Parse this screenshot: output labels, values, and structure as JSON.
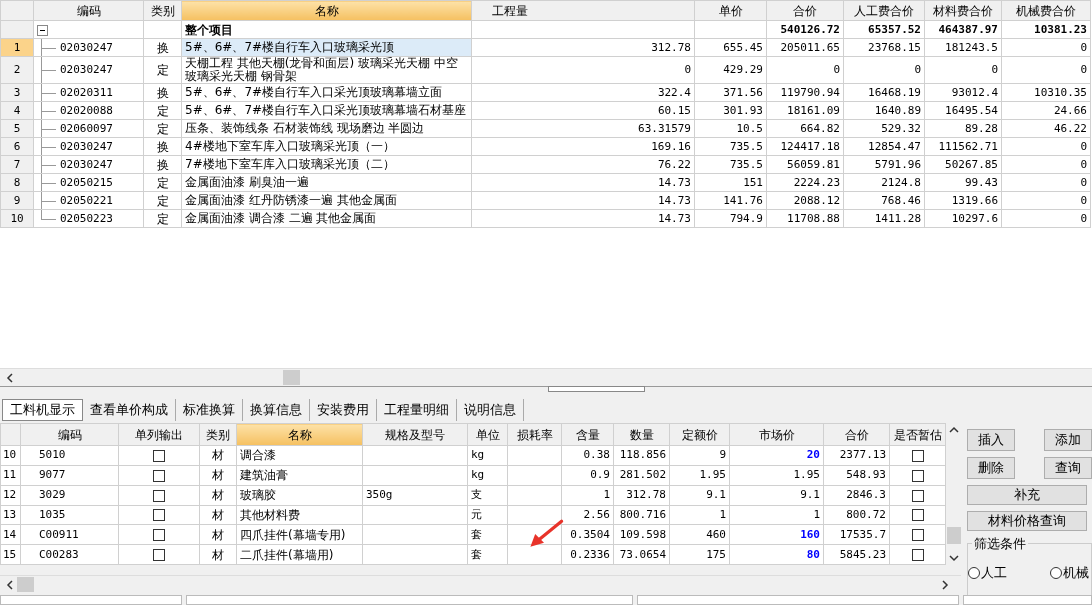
{
  "top_table": {
    "columns": [
      {
        "label": "编码",
        "selected": false
      },
      {
        "label": "类别",
        "selected": false
      },
      {
        "label": "名称",
        "selected": true
      },
      {
        "label": "工程量",
        "selected": false
      },
      {
        "label": "单价",
        "selected": false
      },
      {
        "label": "合价",
        "selected": false
      },
      {
        "label": "人工费合价",
        "selected": false
      },
      {
        "label": "材料费合价",
        "selected": false
      },
      {
        "label": "机械费合价",
        "selected": false
      }
    ],
    "root": {
      "name": "整个项目",
      "expanded": true,
      "total": "540126.72",
      "labor": "65357.52",
      "material": "464387.97",
      "machine": "10381.23",
      "children": [
        {
          "num": "1",
          "code": "02030247",
          "type": "换",
          "name": "5#、6#、7#楼自行车入口玻璃采光顶",
          "qty": "312.78",
          "price": "655.45",
          "total": "205011.65",
          "labor": "23768.15",
          "material": "181243.5",
          "machine": "0",
          "selected": true
        },
        {
          "num": "2",
          "code": "02030247",
          "type": "定",
          "name": "天棚工程 其他天棚(龙骨和面层) 玻璃采光天棚 中空玻璃采光天棚 钢骨架",
          "qty": "0",
          "price": "429.29",
          "total": "0",
          "labor": "0",
          "material": "0",
          "machine": "0",
          "selected": false
        },
        {
          "num": "3",
          "code": "02020311",
          "type": "换",
          "name": "5#、6#、7#楼自行车入口采光顶玻璃幕墙立面",
          "qty": "322.4",
          "price": "371.56",
          "total": "119790.94",
          "labor": "16468.19",
          "material": "93012.4",
          "machine": "10310.35",
          "selected": false
        },
        {
          "num": "4",
          "code": "02020088",
          "type": "定",
          "name": "5#、6#、7#楼自行车入口采光顶玻璃幕墙石材基座",
          "qty": "60.15",
          "price": "301.93",
          "total": "18161.09",
          "labor": "1640.89",
          "material": "16495.54",
          "machine": "24.66",
          "selected": false
        },
        {
          "num": "5",
          "code": "02060097",
          "type": "定",
          "name": "压条、装饰线条 石材装饰线 现场磨边 半圆边",
          "qty": "63.31579",
          "price": "10.5",
          "total": "664.82",
          "labor": "529.32",
          "material": "89.28",
          "machine": "46.22",
          "selected": false
        },
        {
          "num": "6",
          "code": "02030247",
          "type": "换",
          "name": "4#楼地下室车库入口玻璃采光顶（一）",
          "qty": "169.16",
          "price": "735.5",
          "total": "124417.18",
          "labor": "12854.47",
          "material": "111562.71",
          "machine": "0",
          "selected": false
        },
        {
          "num": "7",
          "code": "02030247",
          "type": "换",
          "name": "7#楼地下室车库入口玻璃采光顶（二）",
          "qty": "76.22",
          "price": "735.5",
          "total": "56059.81",
          "labor": "5791.96",
          "material": "50267.85",
          "machine": "0",
          "selected": false
        },
        {
          "num": "8",
          "code": "02050215",
          "type": "定",
          "name": "金属面油漆 刷臭油一遍",
          "qty": "14.73",
          "price": "151",
          "total": "2224.23",
          "labor": "2124.8",
          "material": "99.43",
          "machine": "0",
          "selected": false
        },
        {
          "num": "9",
          "code": "02050221",
          "type": "定",
          "name": "金属面油漆 红丹防锈漆一遍 其他金属面",
          "qty": "14.73",
          "price": "141.76",
          "total": "2088.12",
          "labor": "768.46",
          "material": "1319.66",
          "machine": "0",
          "selected": false
        },
        {
          "num": "10",
          "code": "02050223",
          "type": "定",
          "name": "金属面油漆 调合漆 二遍 其他金属面",
          "qty": "14.73",
          "price": "794.9",
          "total": "11708.88",
          "labor": "1411.28",
          "material": "10297.6",
          "machine": "0",
          "selected": false
        }
      ]
    }
  },
  "tabs": [
    {
      "label": "工料机显示",
      "selected": true
    },
    {
      "label": "查看单价构成",
      "selected": false
    },
    {
      "label": "标准换算",
      "selected": false
    },
    {
      "label": "换算信息",
      "selected": false
    },
    {
      "label": "安装费用",
      "selected": false
    },
    {
      "label": "工程量明细",
      "selected": false
    },
    {
      "label": "说明信息",
      "selected": false
    }
  ],
  "bottom_table": {
    "columns": [
      {
        "label": "编码",
        "selected": false
      },
      {
        "label": "单列输出",
        "selected": false
      },
      {
        "label": "类别",
        "selected": false
      },
      {
        "label": "名称",
        "selected": true
      },
      {
        "label": "规格及型号",
        "selected": false
      },
      {
        "label": "单位",
        "selected": false
      },
      {
        "label": "损耗率",
        "selected": false
      },
      {
        "label": "含量",
        "selected": false
      },
      {
        "label": "数量",
        "selected": false
      },
      {
        "label": "定额价",
        "selected": false
      },
      {
        "label": "市场价",
        "selected": false
      },
      {
        "label": "合价",
        "selected": false
      },
      {
        "label": "是否暂估",
        "selected": false
      }
    ],
    "rows": [
      {
        "num": "10",
        "code": "5010",
        "output": false,
        "type": "材",
        "name": "调合漆",
        "spec": "",
        "unit": "kg",
        "content": "0.38",
        "qty": "118.856",
        "base_price": "9",
        "market_price": "20",
        "market_changed": true,
        "total": "2377.13",
        "estimated": false
      },
      {
        "num": "11",
        "code": "9077",
        "output": false,
        "type": "材",
        "name": "建筑油膏",
        "spec": "",
        "unit": "kg",
        "content": "0.9",
        "qty": "281.502",
        "base_price": "1.95",
        "market_price": "1.95",
        "market_changed": false,
        "total": "548.93",
        "estimated": false
      },
      {
        "num": "12",
        "code": "3029",
        "output": false,
        "type": "材",
        "name": "玻璃胶",
        "spec": "350g",
        "unit": "支",
        "content": "1",
        "qty": "312.78",
        "base_price": "9.1",
        "market_price": "9.1",
        "market_changed": false,
        "total": "2846.3",
        "estimated": false
      },
      {
        "num": "13",
        "code": "1035",
        "output": false,
        "type": "材",
        "name": "其他材料费",
        "spec": "",
        "unit": "元",
        "content": "2.56",
        "qty": "800.716",
        "base_price": "1",
        "market_price": "1",
        "market_changed": false,
        "total": "800.72",
        "estimated": false
      },
      {
        "num": "14",
        "code": "C00911",
        "output": false,
        "type": "材",
        "name": "四爪挂件(幕墙专用)",
        "spec": "",
        "unit": "套",
        "content": "0.3504",
        "qty": "109.598",
        "base_price": "460",
        "market_price": "160",
        "market_changed": true,
        "total": "17535.7",
        "estimated": false
      },
      {
        "num": "15",
        "code": "C00283",
        "output": false,
        "type": "材",
        "name": "二爪挂件(幕墙用)",
        "spec": "",
        "unit": "套",
        "content": "0.2336",
        "qty": "73.0654",
        "base_price": "175",
        "market_price": "80",
        "market_changed": true,
        "total": "5845.23",
        "estimated": false
      }
    ]
  },
  "side_buttons": [
    "插入",
    "添加",
    "删除",
    "查询",
    "补充",
    "材料价格查询"
  ],
  "filter": {
    "title": "筛选条件",
    "options": [
      {
        "label": "人工",
        "selected": false
      },
      {
        "label": "机械",
        "selected": false
      }
    ]
  }
}
